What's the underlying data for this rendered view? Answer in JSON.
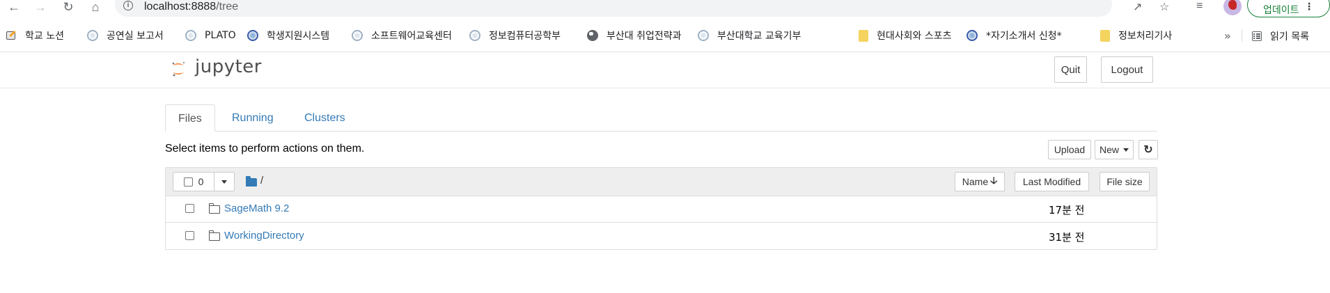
{
  "browser": {
    "url_host": "localhost:8888",
    "url_path": "/tree",
    "update_label": "업데이트",
    "bookmarks": [
      {
        "label": "학교 노션",
        "icon": "notion-pen-icon"
      },
      {
        "label": "공연실 보고서",
        "icon": "university-seal-icon"
      },
      {
        "label": "PLATO",
        "icon": "university-seal-icon"
      },
      {
        "label": "학생지원시스템",
        "icon": "university-seal-icon"
      },
      {
        "label": "소프트웨어교육센터",
        "icon": "university-seal-icon"
      },
      {
        "label": "정보컴퓨터공학부",
        "icon": "university-seal-icon"
      },
      {
        "label": "부산대 취업전략과",
        "icon": "globe-icon"
      },
      {
        "label": "부산대학교 교육기부",
        "icon": "university-seal-icon"
      },
      {
        "label": "현대사회와 스포츠",
        "icon": "folder-icon"
      },
      {
        "label": "*자기소개서 신청*",
        "icon": "university-seal-icon"
      },
      {
        "label": "정보처리기사",
        "icon": "folder-icon"
      }
    ],
    "more_label": "»",
    "reading_list_label": "읽기 목록"
  },
  "header": {
    "logo_text": "jupyter",
    "quit_label": "Quit",
    "logout_label": "Logout"
  },
  "tabs": [
    {
      "label": "Files",
      "active": true
    },
    {
      "label": "Running",
      "active": false
    },
    {
      "label": "Clusters",
      "active": false
    }
  ],
  "actions": {
    "message": "Select items to perform actions on them.",
    "upload_label": "Upload",
    "new_label": "New"
  },
  "list": {
    "selected_count": "0",
    "path": "/",
    "columns": {
      "name": "Name",
      "last_modified": "Last Modified",
      "file_size": "File size"
    },
    "rows": [
      {
        "name": "SageMath 9.2",
        "modified": "17분 전"
      },
      {
        "name": "WorkingDirectory",
        "modified": "31분 전"
      }
    ]
  },
  "colors": {
    "link": "#337ab7",
    "update_green": "#188038",
    "logo_orange": "#f37726"
  }
}
